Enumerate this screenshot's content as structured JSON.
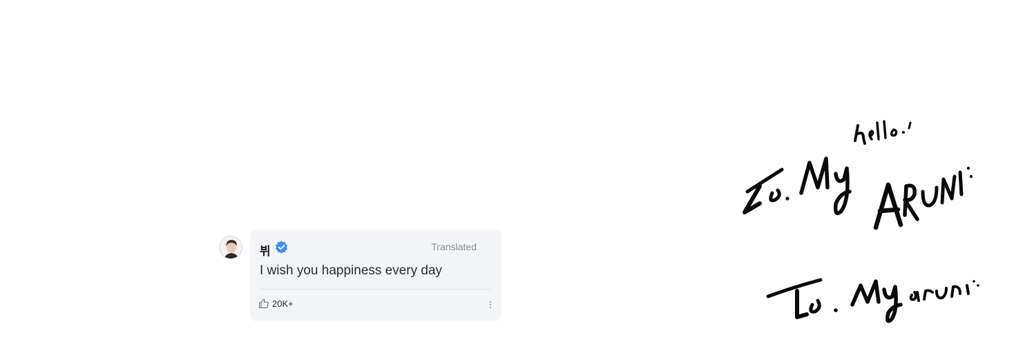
{
  "comment": {
    "username": "뷔",
    "verified_icon": "verified-badge-icon",
    "status_label": "Translated",
    "text": "I wish you happiness every day",
    "likes": "20K+",
    "like_icon": "thumbs-up-icon",
    "more_icon": "more-vertical-icon",
    "accent_color": "#3d8df5"
  },
  "signature": {
    "line1": "To. My hello",
    "line2": "ARUNI",
    "line3": "To. My aruni"
  }
}
